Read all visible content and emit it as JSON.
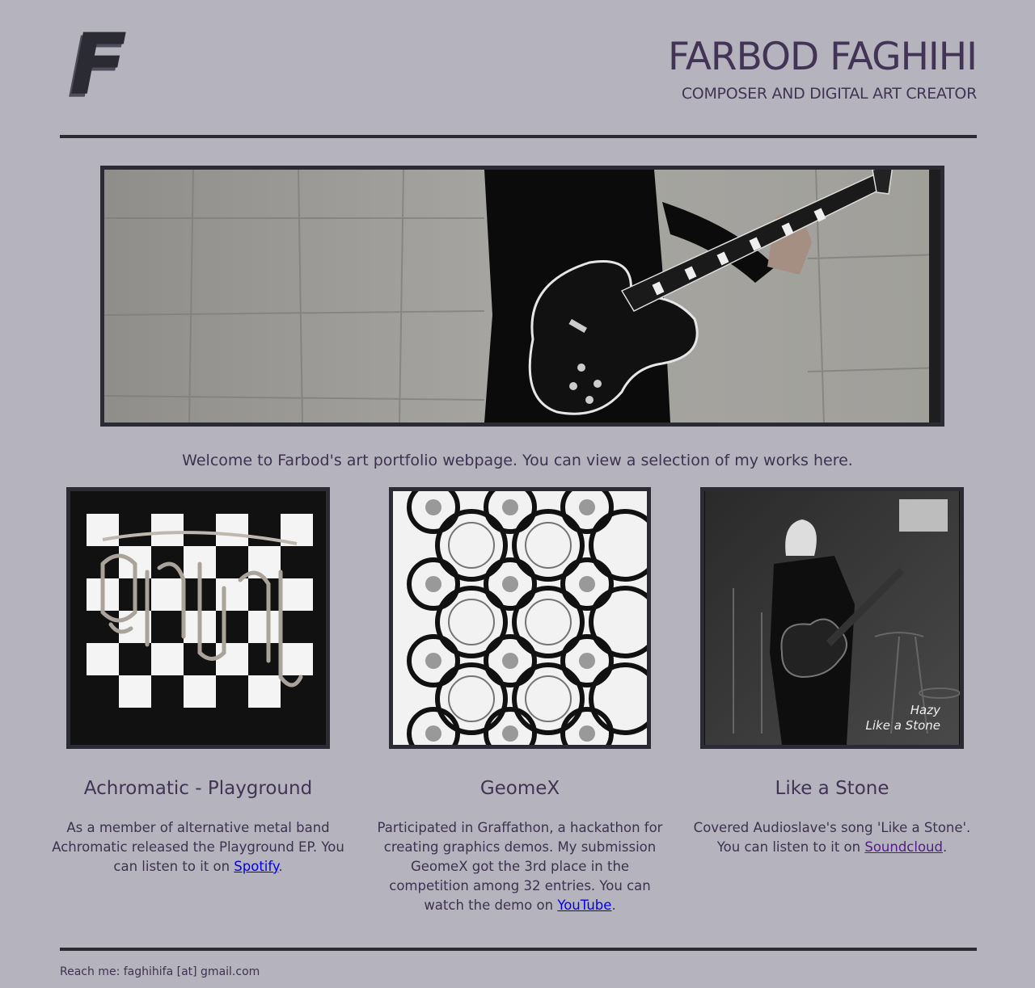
{
  "header": {
    "logo_letter": "F",
    "name": "FARBOD FAGHIHI",
    "subtitle": "COMPOSER AND DIGITAL ART CREATOR"
  },
  "hero": {
    "icon": "guitarist-photo"
  },
  "welcome": "Welcome to Farbod's art portfolio webpage. You can view a selection of my works here.",
  "works": [
    {
      "title": "Achromatic - Playground",
      "desc_before": "As a member of alternative metal band Achromatic released the Playground EP. You can listen to it on ",
      "link_text": "Spotify",
      "desc_after": "."
    },
    {
      "title": "GeomeX",
      "desc_before": "Participated in Graffathon, a hackathon for creating graphics demos. My submission GeomeX got the 3rd place in the competition among 32 entries. You can watch the demo on ",
      "link_text": "YouTube",
      "desc_after": "."
    },
    {
      "title": "Like a Stone",
      "overlay_line1": "Hazy",
      "overlay_line2": "Like a Stone",
      "desc_before": "Covered Audioslave's song 'Like a Stone'. You can listen to it on ",
      "link_text": "Soundcloud",
      "desc_after": "."
    }
  ],
  "footer": "Reach me: faghihifa [at] gmail.com",
  "colors": {
    "background": "#b5b3bd",
    "text": "#3d3250",
    "border": "#2a2b33",
    "link": "#0000ee",
    "visited_link": "#551a8b"
  }
}
